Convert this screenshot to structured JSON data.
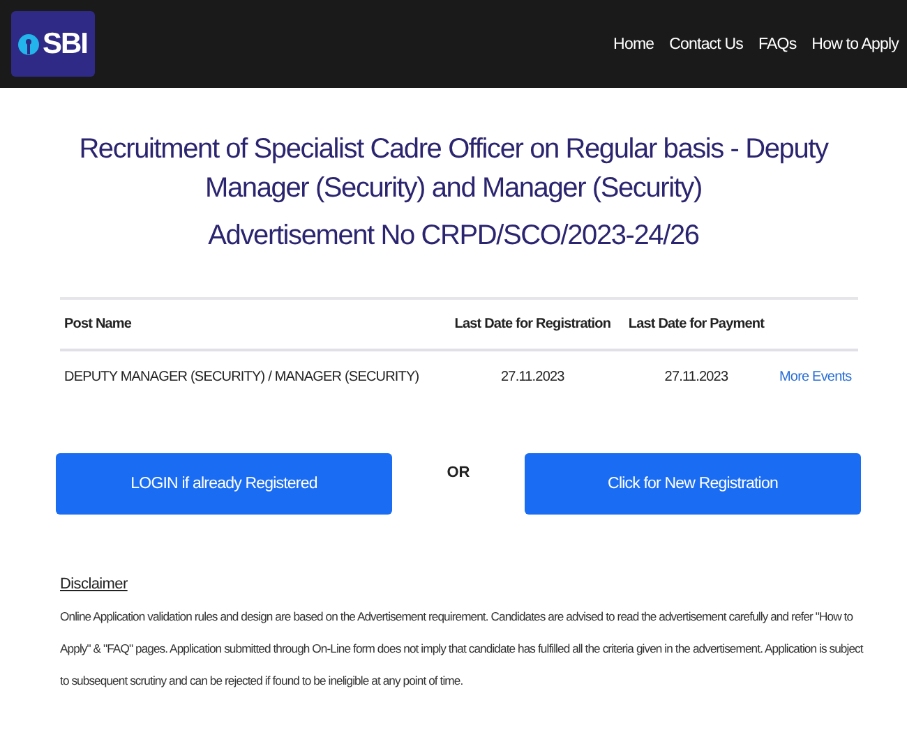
{
  "header": {
    "logo": "SBI",
    "nav": [
      "Home",
      "Contact Us",
      "FAQs",
      "How to Apply"
    ]
  },
  "title": "Recruitment of Specialist Cadre Officer on Regular basis - Deputy Manager (Security) and Manager (Security)",
  "subtitle": "Advertisement No CRPD/SCO/2023-24/26",
  "table": {
    "columns": [
      "Post Name",
      "Last Date for Registration",
      "Last Date for Payment"
    ],
    "rows": [
      {
        "post": "DEPUTY MANAGER (SECURITY) / MANAGER (SECURITY)",
        "registration": "27.11.2023",
        "payment": "27.11.2023",
        "link": "More Events"
      }
    ]
  },
  "actions": {
    "login": "LOGIN if already Registered",
    "separator": "OR",
    "register": "Click for New Registration"
  },
  "disclaimer": {
    "heading": "Disclaimer",
    "text": "Online Application validation rules and design are based on the Advertisement requirement. Candidates are advised to read the advertisement carefully and refer \"How to Apply\" & \"FAQ\" pages. Application submitted through On-Line form does not imply that candidate has fulfilled all the criteria given in the advertisement. Application is subject to subsequent scrutiny and can be rejected if found to be ineligible at any point of time."
  }
}
